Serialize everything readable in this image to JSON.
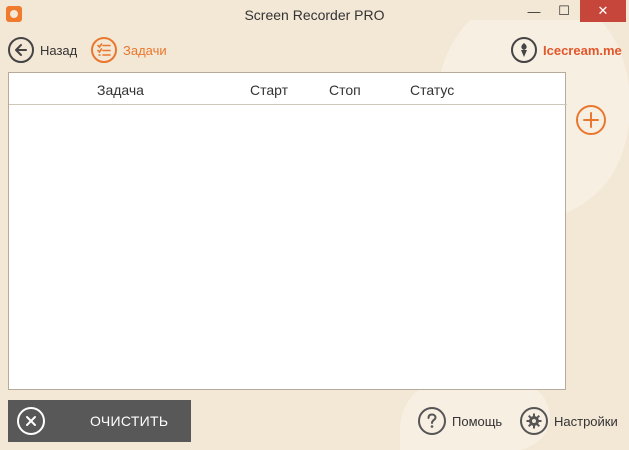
{
  "window": {
    "title": "Screen Recorder PRO",
    "min_glyph": "—",
    "max_glyph": "☐",
    "close_glyph": "✕"
  },
  "toolbar": {
    "back_label": "Назад",
    "tasks_label": "Задачи",
    "brand_label": "Icecream.me"
  },
  "table": {
    "columns": [
      "Задача",
      "Старт",
      "Стоп",
      "Статус"
    ],
    "rows": []
  },
  "footer": {
    "clear_label": "ОЧИСТИТЬ",
    "help_label": "Помощь",
    "settings_label": "Настройки"
  },
  "colors": {
    "background": "#f3e7d6",
    "accent": "#e9782e",
    "brand": "#e2572a",
    "close": "#c7463b",
    "clear_button": "#585858"
  }
}
